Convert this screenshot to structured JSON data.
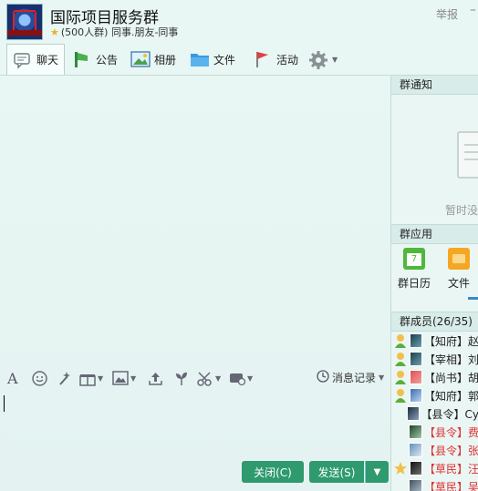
{
  "header": {
    "title": "国际项目服务群",
    "subtitle": "(500人群) 同事.朋友-同事",
    "report_label": "举报"
  },
  "tabs": [
    {
      "label": "聊天",
      "icon": "chat-bubble-icon"
    },
    {
      "label": "公告",
      "icon": "megaphone-icon"
    },
    {
      "label": "相册",
      "icon": "photo-album-icon"
    },
    {
      "label": "文件",
      "icon": "folder-icon"
    },
    {
      "label": "活动",
      "icon": "flag-icon"
    },
    {
      "label": "",
      "icon": "gear-icon"
    }
  ],
  "input_toolbar": {
    "history_label": "消息记录"
  },
  "buttons": {
    "close_label": "关闭(C)",
    "send_label": "发送(S)"
  },
  "sidebar": {
    "notice_title": "群通知",
    "notice_empty": "暂时没",
    "apps_title": "群应用",
    "apps": [
      {
        "label": "群日历",
        "icon": "calendar-icon",
        "badge": "7"
      },
      {
        "label": "文件",
        "icon": "file-folder-icon"
      }
    ],
    "members_title": "群成员(26/35)",
    "members": [
      {
        "name": "【知府】赵",
        "role": "admin",
        "red": false
      },
      {
        "name": "【宰相】刘",
        "role": "admin",
        "red": false
      },
      {
        "name": "【尚书】胡",
        "role": "admin",
        "red": false
      },
      {
        "name": "【知府】郭",
        "role": "admin",
        "red": false
      },
      {
        "name": "【县令】Cy",
        "role": "",
        "red": false
      },
      {
        "name": "【县令】费",
        "role": "",
        "red": true
      },
      {
        "name": "【县令】张",
        "role": "",
        "red": true
      },
      {
        "name": "【草民】汪",
        "role": "owner",
        "red": true
      },
      {
        "name": "【草民】吴",
        "role": "",
        "red": true
      }
    ]
  },
  "colors": {
    "accent": "#2e9a6e",
    "background": "#e7f5f3"
  }
}
